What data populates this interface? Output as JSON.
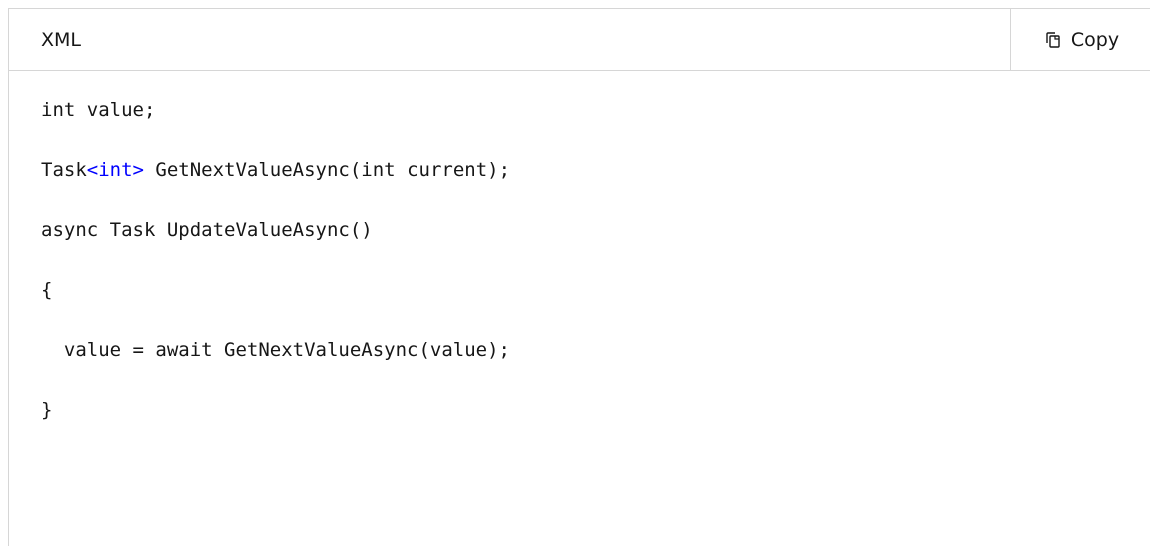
{
  "code_block": {
    "language_label": "XML",
    "copy_label": "Copy",
    "copy_icon": "copy-icon",
    "accent_color": "#0000ff",
    "lines": [
      {
        "parts": [
          "int value;"
        ]
      },
      {
        "pre": "Task",
        "highlight": "<int>",
        "post": " GetNextValueAsync(int current);"
      },
      {
        "parts": [
          "async Task UpdateValueAsync()"
        ]
      },
      {
        "parts": [
          "{"
        ]
      },
      {
        "parts": [
          "  value = await GetNextValueAsync(value);"
        ]
      },
      {
        "parts": [
          "}"
        ]
      }
    ]
  }
}
